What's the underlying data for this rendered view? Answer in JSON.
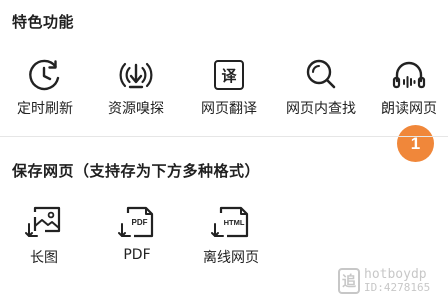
{
  "special": {
    "title": "特色功能",
    "items": [
      {
        "label": "定时刷新",
        "icon": "timer-refresh-icon"
      },
      {
        "label": "资源嗅探",
        "icon": "resource-sniff-icon"
      },
      {
        "label": "网页翻译",
        "icon": "translate-icon"
      },
      {
        "label": "网页内查找",
        "icon": "find-in-page-icon"
      },
      {
        "label": "朗读网页",
        "icon": "read-aloud-icon"
      }
    ]
  },
  "save": {
    "title": "保存网页（支持存为下方多种格式）",
    "items": [
      {
        "label": "长图",
        "icon": "long-image-icon"
      },
      {
        "label": "PDF",
        "icon": "pdf-file-icon",
        "icon_text": "PDF"
      },
      {
        "label": "离线网页",
        "icon": "html-file-icon",
        "icon_text": "HTML"
      }
    ]
  },
  "translate_glyph": "译",
  "badge": {
    "text": "1",
    "color": "#f0873a"
  },
  "watermark": {
    "logo_char": "追",
    "line1": "hotboydp",
    "line2": "ID:4278165"
  }
}
